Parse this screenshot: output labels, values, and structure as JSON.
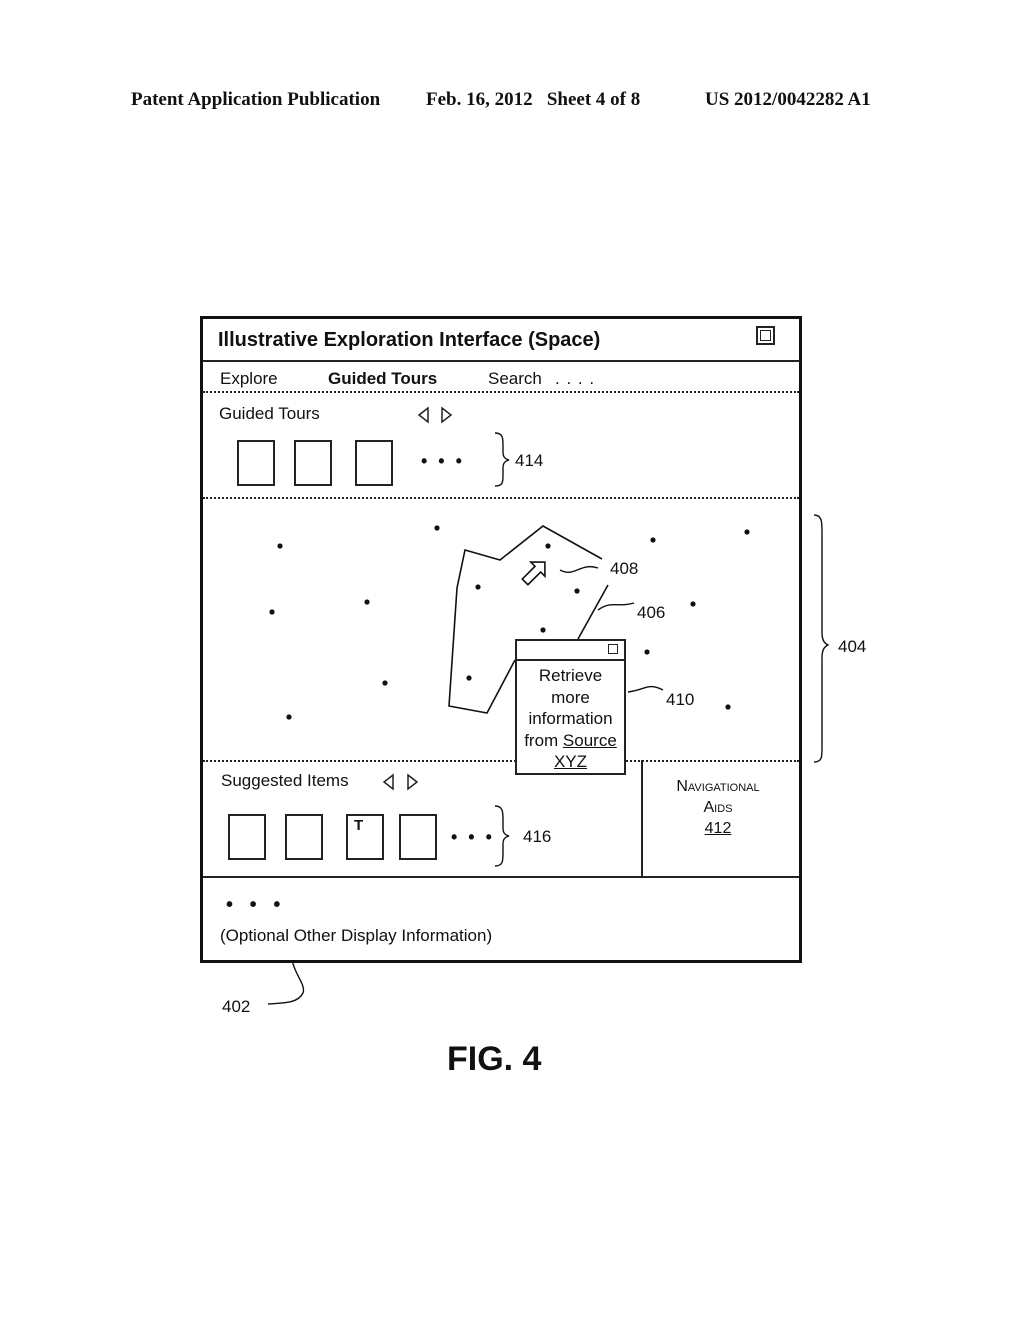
{
  "page_header": {
    "publication": "Patent Application Publication",
    "date_sheet": "Feb. 16, 2012   Sheet 4 of 8",
    "patent_number": "US 2012/0042282 A1"
  },
  "window": {
    "title": "Illustrative Exploration Interface (Space)",
    "maximize_icon": "window-maximize-icon",
    "menu": [
      {
        "label": "Explore",
        "bold": false
      },
      {
        "label": "Guided Tours",
        "bold": true
      },
      {
        "label": "Search",
        "bold": false
      }
    ],
    "menu_more": ". . . .",
    "guided_tours": {
      "label": "Guided Tours",
      "nav_icons": [
        "triangle-left-icon",
        "triangle-right-icon"
      ],
      "thumbnail_count": 3,
      "ellipsis": "• • •",
      "ref": "414"
    },
    "space_view": {
      "ref": "404",
      "polygon_ref": "406",
      "arrow_ref": "408",
      "arrow_icon": "arrow-up-right-icon",
      "popup": {
        "ref": "410",
        "close_icon": "square-icon",
        "line1": "Retrieve",
        "line2": "more",
        "line3": "information",
        "line4_prefix": "from ",
        "link_source": "Source",
        "link_xyz": "XYZ"
      }
    },
    "suggested_items": {
      "label": "Suggested Items",
      "nav_icons": [
        "triangle-left-icon",
        "triangle-right-icon"
      ],
      "thumbnails": [
        "",
        "",
        "T",
        ""
      ],
      "ellipsis": "• • •",
      "ref": "416"
    },
    "navigational_aids": {
      "line1": "Navigational",
      "line2": "Aids",
      "ref": "412"
    },
    "other_info": {
      "dots": "•   •   •",
      "label": "(Optional Other Display Information)"
    },
    "ref": "402"
  },
  "figure_caption": "FIG. 4"
}
